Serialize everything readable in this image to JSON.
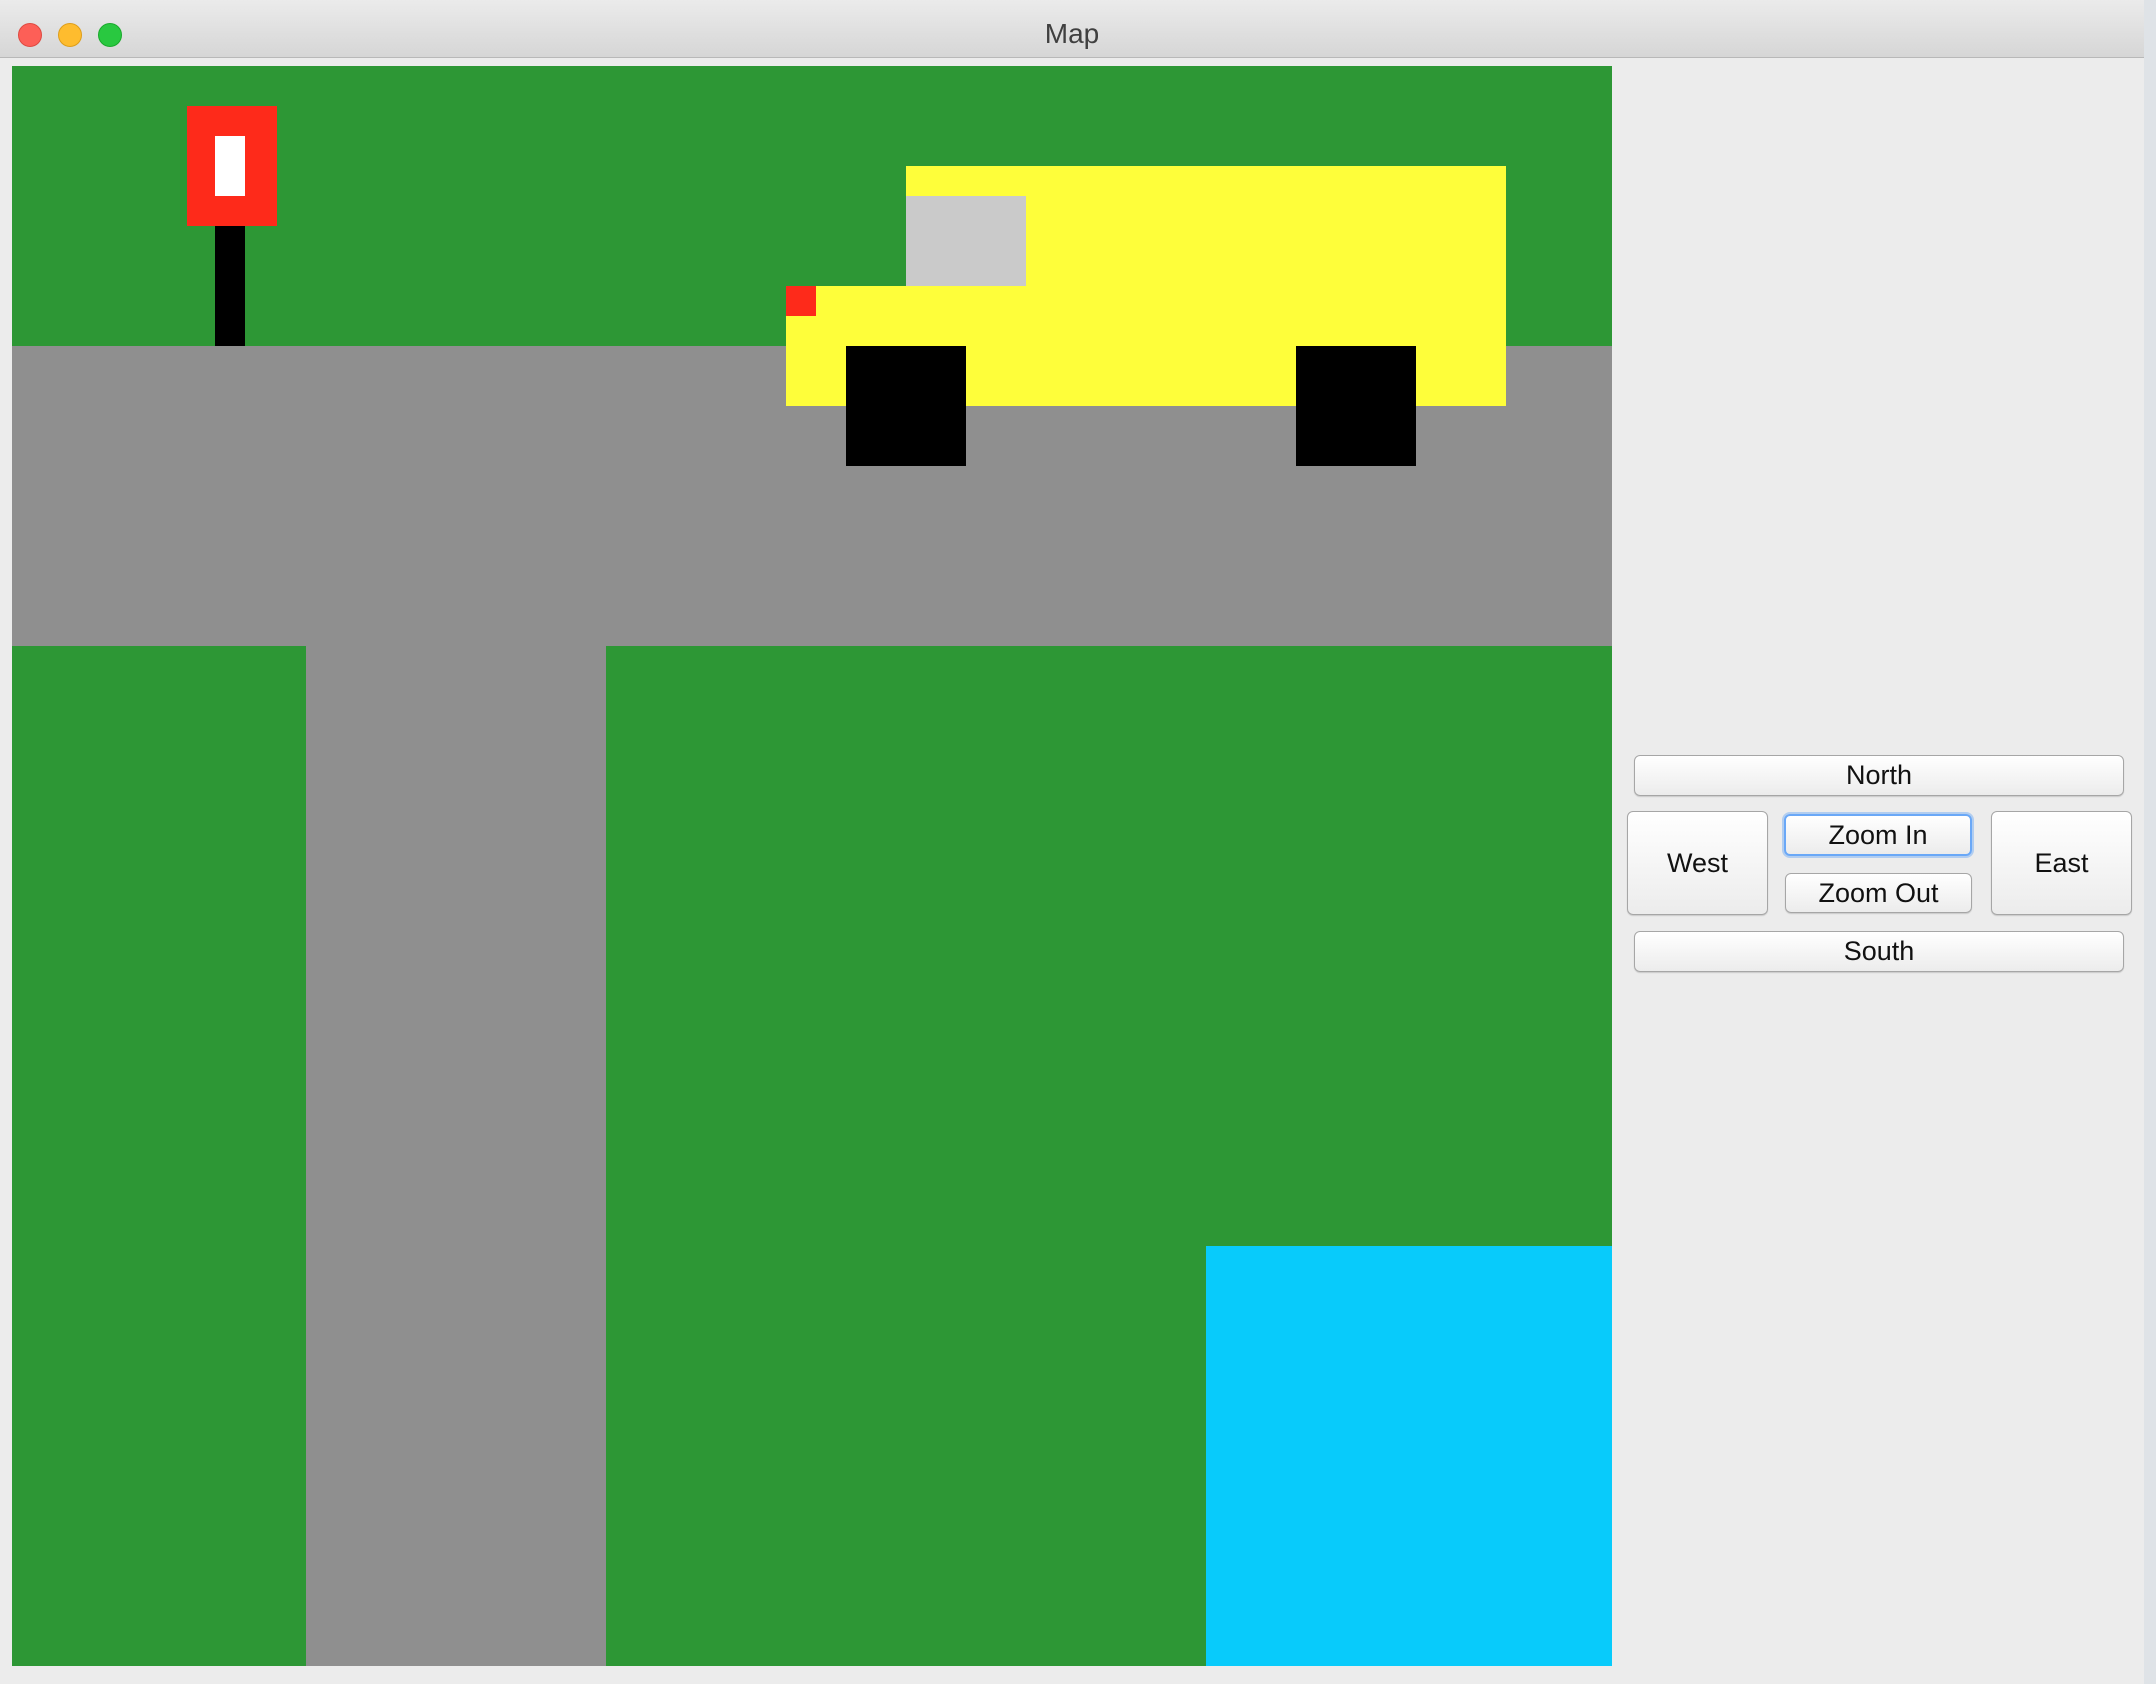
{
  "window": {
    "title": "Map"
  },
  "controls": {
    "north": "North",
    "west": "West",
    "zoom_in": "Zoom In",
    "zoom_out": "Zoom Out",
    "east": "East",
    "south": "South",
    "focused": "zoom_in"
  },
  "colors": {
    "grass": "#2d9735",
    "road": "#8f8f8f",
    "water": "#08cbfb",
    "sign_red": "#fe2a1a",
    "truck_yellow": "#fefe3a",
    "truck_window": "#cacaca",
    "wheel": "#000000"
  },
  "map": {
    "tile_types": [
      "grass",
      "road",
      "water",
      "post-sign",
      "delivery-truck"
    ]
  }
}
